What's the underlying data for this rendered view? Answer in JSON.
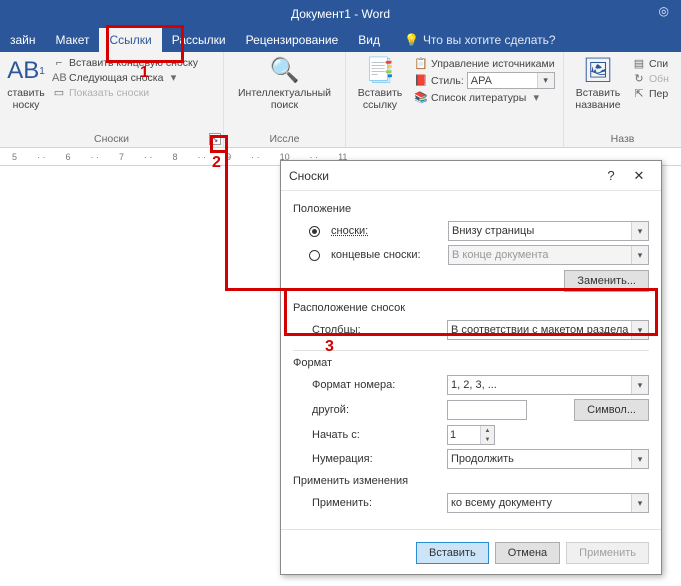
{
  "title": "Документ1 - Word",
  "tabs": [
    "зайн",
    "Макет",
    "Ссылки",
    "Рассылки",
    "Рецензирование",
    "Вид"
  ],
  "active_tab": "Ссылки",
  "tell_me": "Что вы хотите сделать?",
  "ribbon": {
    "footnotes": {
      "big_btn": "ставить носку",
      "items": [
        "Вставить концевую сноску",
        "Следующая сноска",
        "Показать сноски"
      ],
      "title": "Сноски"
    },
    "research": {
      "big_btn": "Интеллектуальный поиск",
      "title": "Иссле"
    },
    "citations": {
      "big_btn": "Вставить ссылку",
      "items": [
        "Управление источниками",
        "Стиль:",
        "Список литературы"
      ],
      "style_value": "APA",
      "title": ""
    },
    "captions": {
      "big_btn": "Вставить название",
      "items": [
        "Спи",
        "Обн",
        "Пер"
      ],
      "title": "Назв"
    }
  },
  "ruler": [
    "5",
    "6",
    "7",
    "8",
    "9",
    "10",
    "11"
  ],
  "annotations": {
    "n1": "1",
    "n2": "2",
    "n3": "3"
  },
  "dialog": {
    "title": "Сноски",
    "sec_position": "Положение",
    "radio_footnotes": "сноски:",
    "radio_endnotes": "концевые сноски:",
    "combo_footnotes": "Внизу страницы",
    "combo_endnotes": "В конце документа",
    "btn_replace": "Заменить...",
    "sec_layout": "Расположение сносок",
    "lbl_columns": "Столбцы:",
    "combo_columns": "В соответствии с макетом раздела",
    "sec_format": "Формат",
    "lbl_numformat": "Формат номера:",
    "combo_numformat": "1, 2, 3, ...",
    "lbl_custom": "другой:",
    "btn_symbol": "Символ...",
    "lbl_startat": "Начать с:",
    "val_startat": "1",
    "lbl_numbering": "Нумерация:",
    "combo_numbering": "Продолжить",
    "sec_apply": "Применить изменения",
    "lbl_applyto": "Применить:",
    "combo_applyto": "ко всему документу",
    "btn_insert": "Вставить",
    "btn_cancel": "Отмена",
    "btn_apply": "Применить"
  }
}
